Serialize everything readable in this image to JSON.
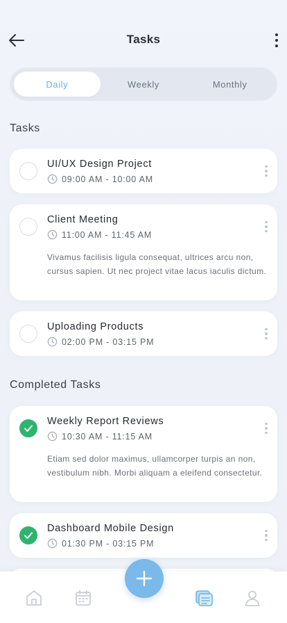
{
  "header": {
    "title": "Tasks"
  },
  "tabs": [
    {
      "label": "Daily",
      "active": true
    },
    {
      "label": "Weekly",
      "active": false
    },
    {
      "label": "Monthly",
      "active": false
    }
  ],
  "sections": {
    "tasks_title": "Tasks",
    "completed_title": "Completed Tasks"
  },
  "tasks": [
    {
      "title": "UI/UX Design Project",
      "time": "09:00 AM - 10:00 AM",
      "description": "",
      "done": false
    },
    {
      "title": "Client Meeting",
      "time": "11:00 AM - 11:45 AM",
      "description": "Vivamus facilisis ligula consequat, ultrices arcu non, cursus sapien. Ut nec project vitae lacus iaculis dictum.",
      "done": false
    },
    {
      "title": "Uploading Products",
      "time": "02:00 PM - 03:15 PM",
      "description": "",
      "done": false
    }
  ],
  "completed": [
    {
      "title": "Weekly Report Reviews",
      "time": "10:30 AM - 11:15 AM",
      "description": "Etiam sed dolor maximus, ullamcorper turpis an non, vestibulum nibh. Morbi aliquam a eleifend consectetur.",
      "done": true
    },
    {
      "title": "Dashboard Mobile Design",
      "time": "01:30 PM - 03:15 PM",
      "description": "",
      "done": true
    }
  ],
  "colors": {
    "accent": "#6cb3e6",
    "fab": "#7ab9ea",
    "done": "#2fb46f"
  },
  "nav": {
    "items": [
      {
        "icon": "home-icon"
      },
      {
        "icon": "calendar-icon"
      },
      {
        "icon": "tasks-icon",
        "active": true
      },
      {
        "icon": "profile-icon"
      }
    ],
    "fab_icon": "plus-icon"
  }
}
